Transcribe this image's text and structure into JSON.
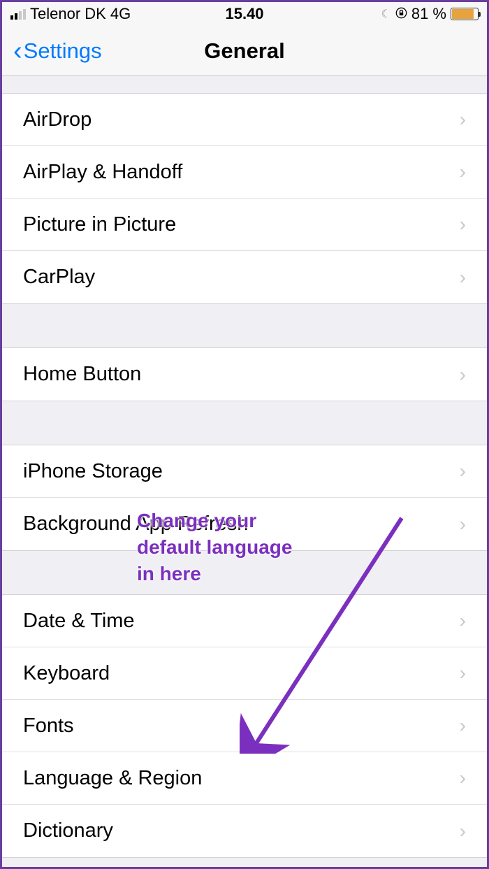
{
  "status": {
    "carrier": "Telenor DK",
    "network": "4G",
    "time": "15.40",
    "battery_pct": "81 %"
  },
  "nav": {
    "back_label": "Settings",
    "title": "General"
  },
  "groups": [
    {
      "items": [
        {
          "label": "AirDrop"
        },
        {
          "label": "AirPlay & Handoff"
        },
        {
          "label": "Picture in Picture"
        },
        {
          "label": "CarPlay"
        }
      ]
    },
    {
      "items": [
        {
          "label": "Home Button"
        }
      ]
    },
    {
      "items": [
        {
          "label": "iPhone Storage"
        },
        {
          "label": "Background App Refresh"
        }
      ]
    },
    {
      "items": [
        {
          "label": "Date & Time"
        },
        {
          "label": "Keyboard"
        },
        {
          "label": "Fonts"
        },
        {
          "label": "Language & Region"
        },
        {
          "label": "Dictionary"
        }
      ]
    }
  ],
  "annotation": {
    "text": "Change your\ndefault language\nin here"
  }
}
